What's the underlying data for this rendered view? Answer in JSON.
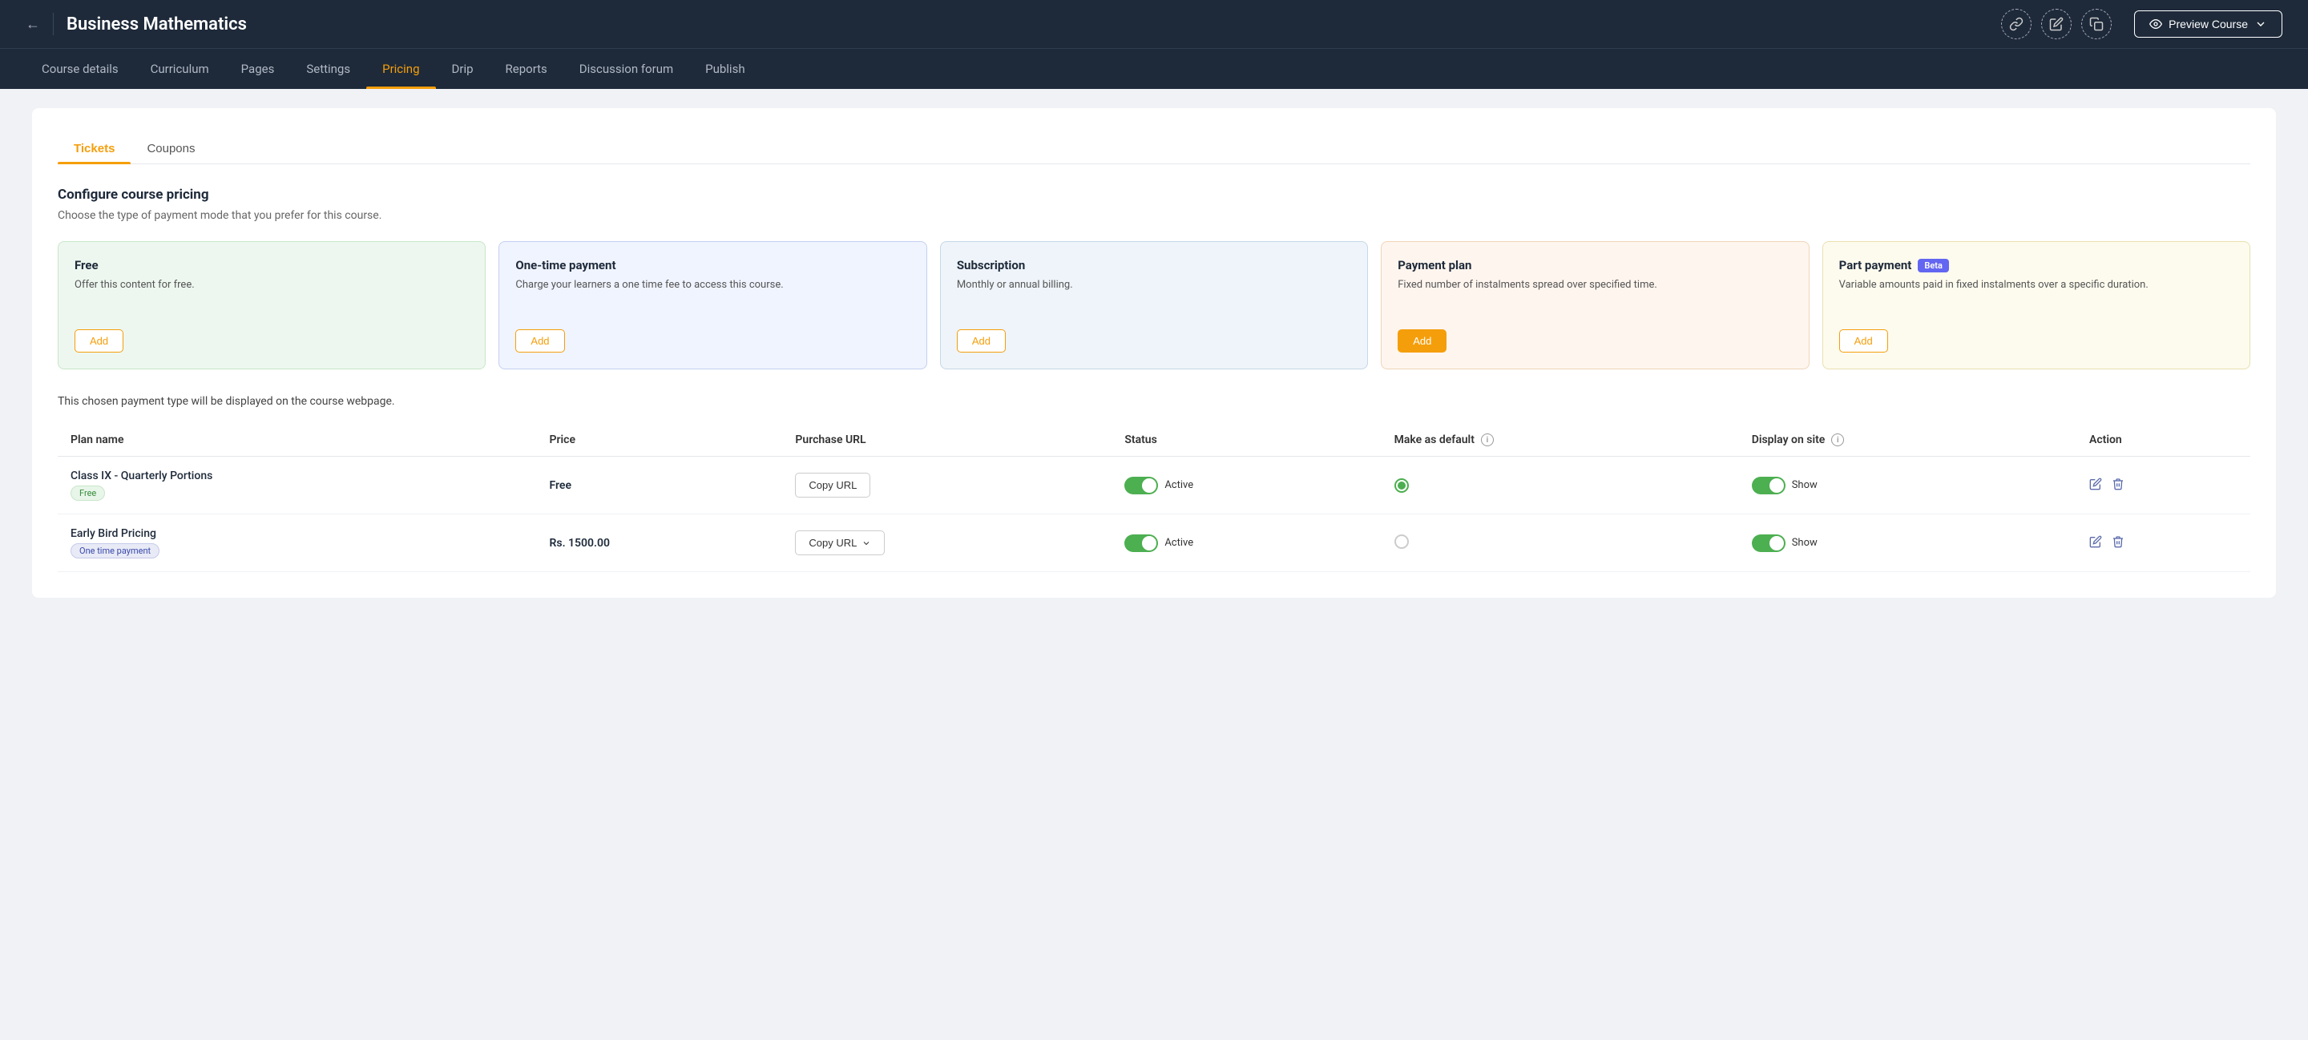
{
  "header": {
    "back_label": "←",
    "course_title": "Business Mathematics",
    "icons": [
      "link-icon",
      "edit-icon",
      "copy-icon"
    ],
    "preview_label": "Preview Course"
  },
  "nav": {
    "tabs": [
      {
        "id": "course-details",
        "label": "Course details",
        "active": false
      },
      {
        "id": "curriculum",
        "label": "Curriculum",
        "active": false
      },
      {
        "id": "pages",
        "label": "Pages",
        "active": false
      },
      {
        "id": "settings",
        "label": "Settings",
        "active": false
      },
      {
        "id": "pricing",
        "label": "Pricing",
        "active": true
      },
      {
        "id": "drip",
        "label": "Drip",
        "active": false
      },
      {
        "id": "reports",
        "label": "Reports",
        "active": false
      },
      {
        "id": "discussion-forum",
        "label": "Discussion forum",
        "active": false
      },
      {
        "id": "publish",
        "label": "Publish",
        "active": false
      }
    ]
  },
  "inner_tabs": [
    {
      "id": "tickets",
      "label": "Tickets",
      "active": true
    },
    {
      "id": "coupons",
      "label": "Coupons",
      "active": false
    }
  ],
  "pricing_config": {
    "title": "Configure course pricing",
    "desc": "Choose the type of payment mode that you prefer for this course.",
    "cards": [
      {
        "id": "free",
        "title": "Free",
        "desc": "Offer this content for free.",
        "btn_label": "Add",
        "btn_filled": false,
        "beta": false
      },
      {
        "id": "one-time-payment",
        "title": "One-time payment",
        "desc": "Charge your learners a one time fee to access this course.",
        "btn_label": "Add",
        "btn_filled": false,
        "beta": false
      },
      {
        "id": "subscription",
        "title": "Subscription",
        "desc": "Monthly or annual billing.",
        "btn_label": "Add",
        "btn_filled": false,
        "beta": false
      },
      {
        "id": "payment-plan",
        "title": "Payment plan",
        "desc": "Fixed number of instalments spread over specified time.",
        "btn_label": "Add",
        "btn_filled": true,
        "beta": false
      },
      {
        "id": "part-payment",
        "title": "Part payment",
        "desc": "Variable amounts paid in fixed instalments over a specific duration.",
        "btn_label": "Add",
        "btn_filled": false,
        "beta": true,
        "beta_label": "Beta"
      }
    ]
  },
  "table": {
    "note": "This chosen payment type will be displayed on the course webpage.",
    "columns": [
      {
        "id": "plan-name",
        "label": "Plan name"
      },
      {
        "id": "price",
        "label": "Price"
      },
      {
        "id": "purchase-url",
        "label": "Purchase URL"
      },
      {
        "id": "status",
        "label": "Status"
      },
      {
        "id": "make-as-default",
        "label": "Make as default",
        "has_info": true
      },
      {
        "id": "display-on-site",
        "label": "Display on site",
        "has_info": true
      },
      {
        "id": "action",
        "label": "Action"
      }
    ],
    "rows": [
      {
        "plan_name": "Class IX - Quarterly Portions",
        "plan_tag": "Free",
        "plan_tag_type": "free",
        "price": "Free",
        "copy_url_label": "Copy URL",
        "copy_url_has_dropdown": false,
        "status_active": true,
        "status_label": "Active",
        "is_default": true,
        "display_on_site": true,
        "show_label": "Show"
      },
      {
        "plan_name": "Early Bird Pricing",
        "plan_tag": "One time payment",
        "plan_tag_type": "otp",
        "price": "Rs. 1500.00",
        "copy_url_label": "Copy URL",
        "copy_url_has_dropdown": true,
        "status_active": true,
        "status_label": "Active",
        "is_default": false,
        "display_on_site": true,
        "show_label": "Show"
      }
    ]
  }
}
